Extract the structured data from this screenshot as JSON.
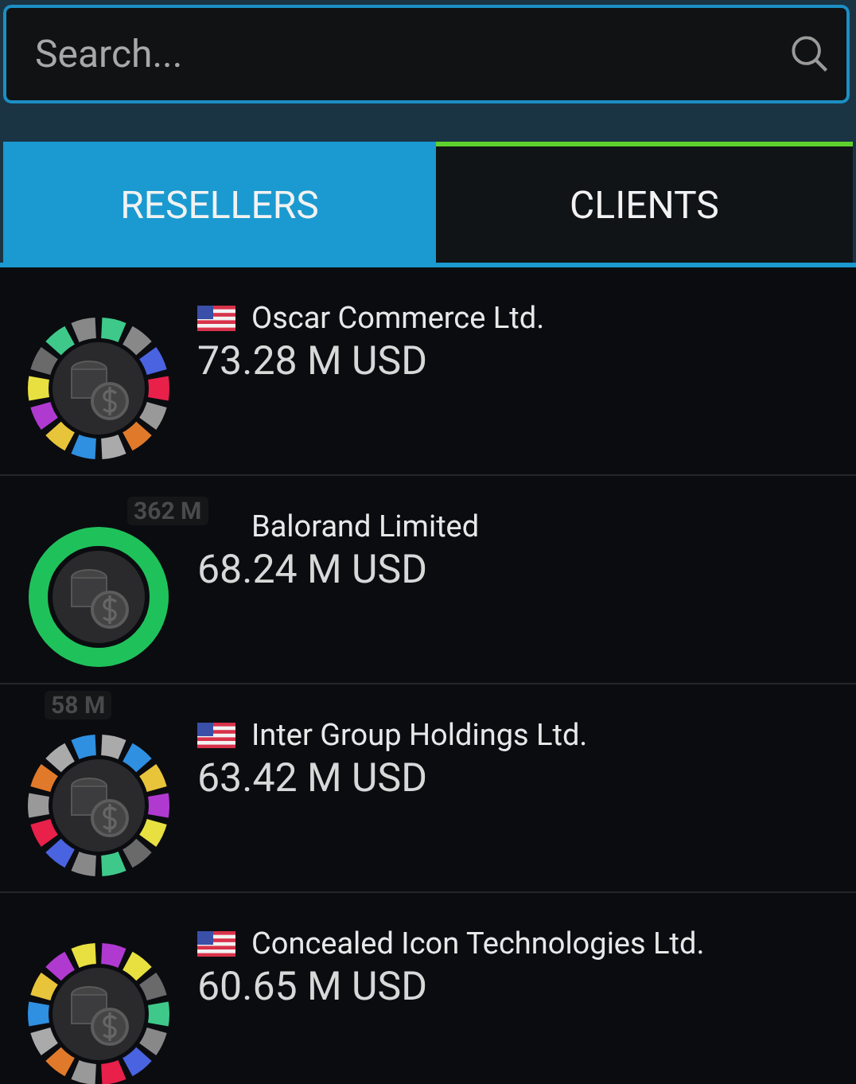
{
  "search": {
    "placeholder": "Search..."
  },
  "tabs": [
    {
      "label": "RESELLERS",
      "selected": true
    },
    {
      "label": "CLIENTS",
      "selected": false
    }
  ],
  "map_badges": [
    {
      "label": "362 M"
    },
    {
      "label": "58 M"
    }
  ],
  "rows": [
    {
      "name": "Oscar Commerce Ltd.",
      "amount": "73.28 M USD",
      "flag": true,
      "kind": "segmented"
    },
    {
      "name": "Balorand Limited",
      "amount": "68.24 M USD",
      "flag": false,
      "kind": "solid"
    },
    {
      "name": "Inter Group Holdings Ltd.",
      "amount": "63.42 M USD",
      "flag": true,
      "kind": "segmented"
    },
    {
      "name": "Concealed Icon Technologies Ltd.",
      "amount": "60.65 M USD",
      "flag": true,
      "kind": "segmented"
    }
  ]
}
